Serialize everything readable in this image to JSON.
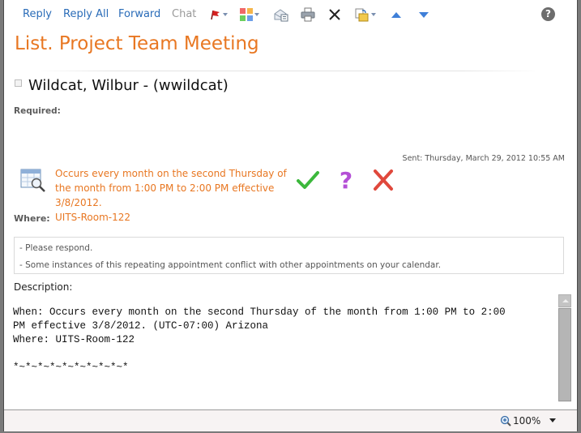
{
  "toolbar": {
    "reply": "Reply",
    "reply_all": "Reply All",
    "forward": "Forward",
    "chat": "Chat",
    "help": "?",
    "icons": [
      "flag-icon",
      "categorize-icon",
      "open-email-icon",
      "print-icon",
      "delete-icon",
      "move-icon",
      "previous-item-icon",
      "next-item-icon",
      "help-icon"
    ]
  },
  "message": {
    "title": "List. Project Team Meeting",
    "sender": "Wildcat, Wilbur - (wwildcat)",
    "required_label": "Required:",
    "sent": "Sent: Thursday, March 29, 2012 10:55 AM",
    "occurs": "Occurs every month on the second Thursday of the month from 1:00 PM to 2:00 PM effective 3/8/2012.",
    "where_label": "Where:",
    "where_value": "UITS-Room-122"
  },
  "response_buttons": {
    "accept": "accept",
    "tentative": "tentative",
    "decline": "decline"
  },
  "info": {
    "lines": [
      "- Please respond.",
      "- Some instances of this repeating appointment conflict with other appointments on your calendar."
    ]
  },
  "description": {
    "label": "Description:",
    "body": "When: Occurs every month on the second Thursday of the month from 1:00 PM to 2:00\nPM effective 3/8/2012. (UTC-07:00) Arizona\nWhere: UITS-Room-122\n\n*~*~*~*~*~*~*~*~*~*"
  },
  "status_bar": {
    "zoom": "100%"
  },
  "colors": {
    "accent_orange": "#e87722",
    "link_blue": "#2a6cb8",
    "accept_green": "#3cb83c",
    "tentative_purple": "#b44fd6",
    "decline_red": "#e0483c"
  }
}
